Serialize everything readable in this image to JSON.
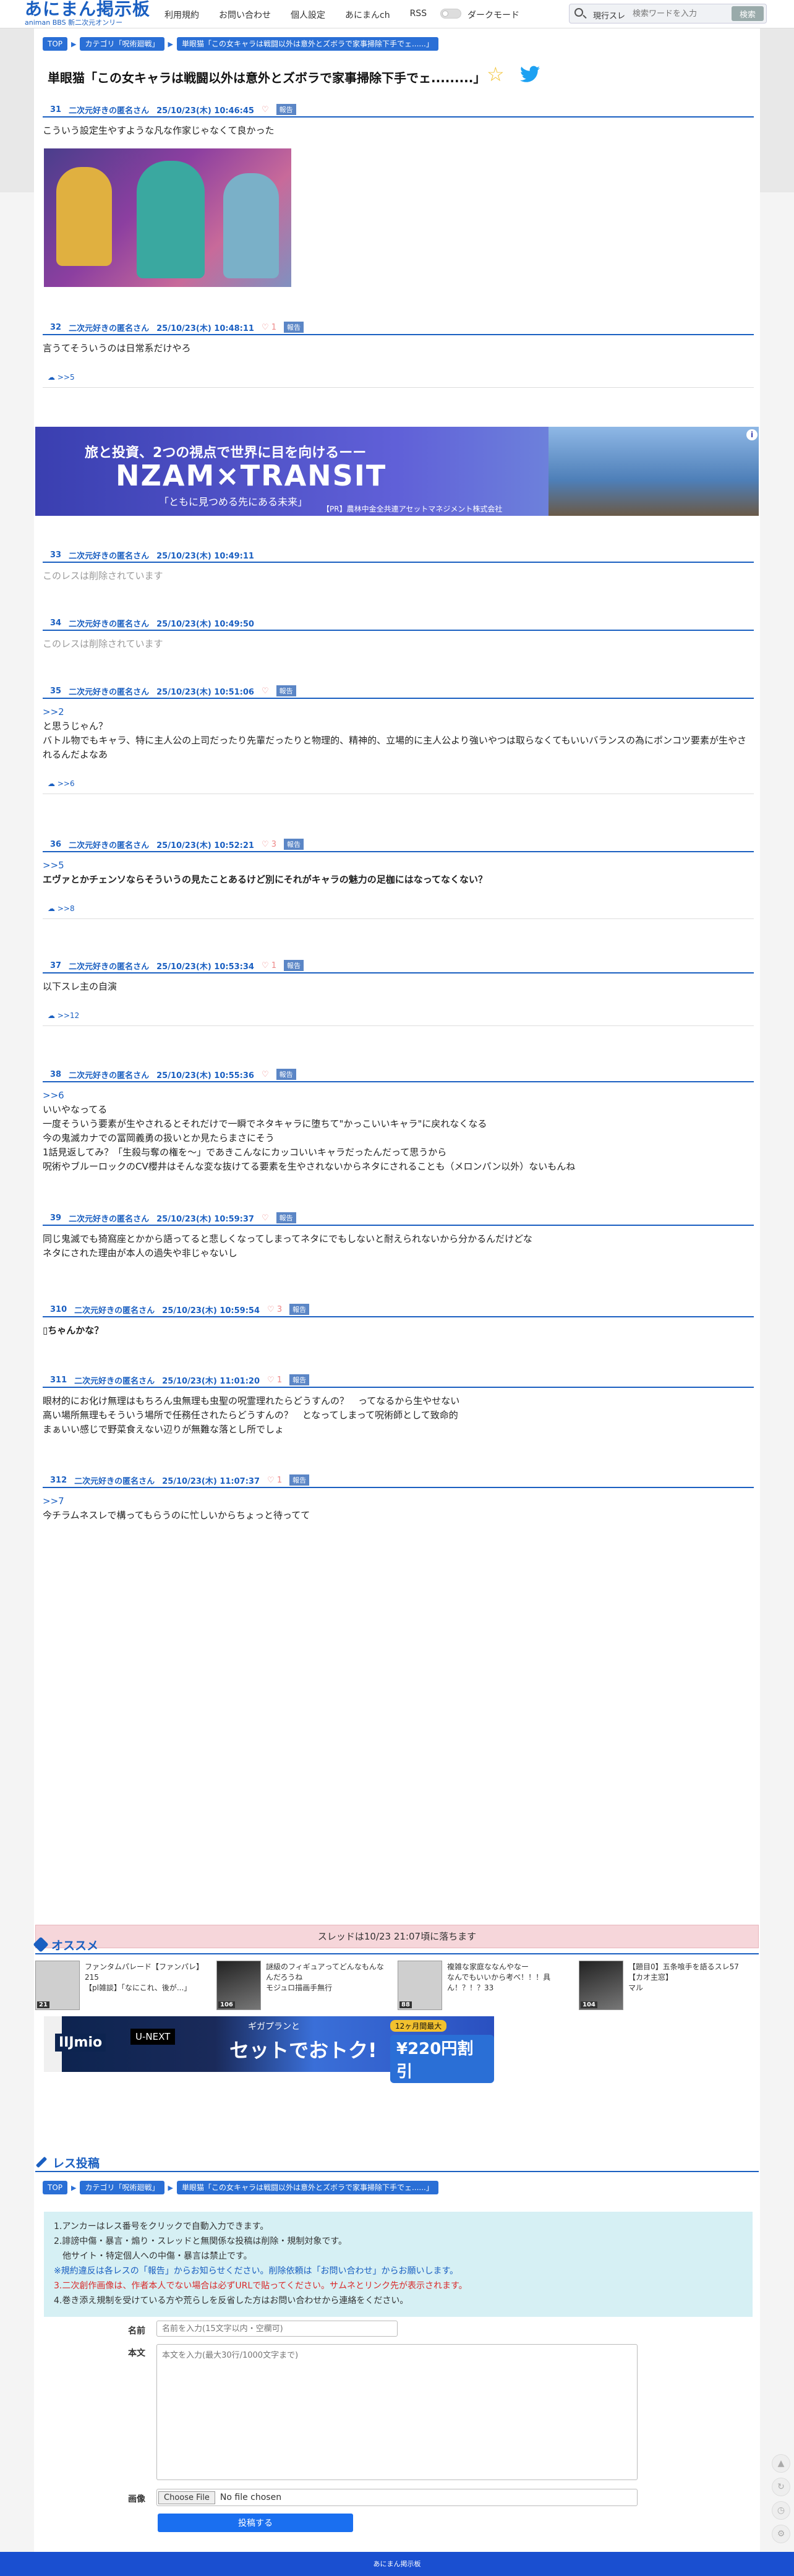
{
  "header": {
    "logo": "あにまん掲示板",
    "logo_sub": "animan BBS 新二次元オンリー",
    "nav": [
      "利用規約",
      "お問い合わせ",
      "個人設定",
      "あにまんch",
      "RSS"
    ],
    "dark_mode_label": "ダークモード",
    "search_scope": "現行スレ",
    "search_placeholder": "検索ワードを入力",
    "search_button": "検索"
  },
  "breadcrumb": {
    "top": "TOP",
    "category": "カテゴリ「呪術廻戦」",
    "thread": "単眼猫「この女キャラは戦闘以外は意外とズボラで家事掃除下手でェ......」"
  },
  "thread_title": "単眼猫「この女キャラは戦闘以外は意外とズボラで家事掃除下手でェ.........」",
  "posts": [
    {
      "num": "31",
      "name": "二次元好きの匿名さん",
      "date": "25/10/23(木) 10:46:45",
      "likes": "",
      "report": "報告",
      "lines": [
        "こういう設定生やすような凡な作家じゃなくて良かった"
      ]
    },
    {
      "num": "32",
      "name": "二次元好きの匿名さん",
      "date": "25/10/23(木) 10:48:11",
      "likes": "1",
      "report": "報告",
      "lines": [
        "言うてそういうのは日常系だけやろ"
      ],
      "replies": ">>5"
    },
    {
      "num": "33",
      "name": "二次元好きの匿名さん",
      "date": "25/10/23(木) 10:49:11",
      "deleted": "このレスは削除されています"
    },
    {
      "num": "34",
      "name": "二次元好きの匿名さん",
      "date": "25/10/23(木) 10:49:50",
      "deleted": "このレスは削除されています"
    },
    {
      "num": "35",
      "name": "二次元好きの匿名さん",
      "date": "25/10/23(木) 10:51:06",
      "likes": "",
      "report": "報告",
      "anchor": ">>2",
      "lines": [
        "と思うじゃん？",
        "バトル物でもキャラ、特に主人公の上司だったり先輩だったりと物理的、精神的、立場的に主人公より強いやつは取らなくてもいいバランスの為にポンコツ要素が生やされるんだよなあ"
      ],
      "replies": ">>6"
    },
    {
      "num": "36",
      "name": "二次元好きの匿名さん",
      "date": "25/10/23(木) 10:52:21",
      "likes": "3",
      "report": "報告",
      "anchor": ">>5",
      "lines": [
        "エヴァとかチェンソならそういうの見たことあるけど別にそれがキャラの魅力の足枷にはなってなくない？"
      ],
      "replies": ">>8"
    },
    {
      "num": "37",
      "name": "二次元好きの匿名さん",
      "date": "25/10/23(木) 10:53:34",
      "likes": "1",
      "report": "報告",
      "lines": [
        "以下スレ主の自演"
      ],
      "replies": ">>12"
    },
    {
      "num": "38",
      "name": "二次元好きの匿名さん",
      "date": "25/10/23(木) 10:55:36",
      "likes": "",
      "report": "報告",
      "anchor": ">>6",
      "lines": [
        "いいやなってる",
        "一度そういう要素が生やされるとそれだけで一瞬でネタキャラに堕ちて\"かっこいいキャラ\"に戻れなくなる",
        "今の鬼滅カナでの冨岡義勇の扱いとか見たらまさにそう",
        "1話見返してみ？「生殺与奪の権を〜」であきこんなにカッコいいキャラだったんだって思うから",
        "呪術やブルーロックのCV櫻井はそんな変な抜けてる要素を生やされないからネタにされることも（メロンパン以外）ないもんね"
      ]
    },
    {
      "num": "39",
      "name": "二次元好きの匿名さん",
      "date": "25/10/23(木) 10:59:37",
      "likes": "",
      "report": "報告",
      "lines": [
        "同じ鬼滅でも猗窩座とかから語ってると悲しくなってしまってネタにでもしないと耐えられないから分かるんだけどな",
        "ネタにされた理由が本人の過失や非じゃないし"
      ]
    },
    {
      "num": "310",
      "name": "二次元好きの匿名さん",
      "date": "25/10/23(木) 10:59:54",
      "likes": "3",
      "report": "報告",
      "lines": [
        "▯ちゃんかな？"
      ]
    },
    {
      "num": "311",
      "name": "二次元好きの匿名さん",
      "date": "25/10/23(木) 11:01:20",
      "likes": "1",
      "report": "報告",
      "lines": [
        "眼材的にお化け無理はもちろん虫無理も虫聖の呪霊理れたらどうすんの？　ってなるから生やせない",
        "高い場所無理もそういう場所で任務任されたらどうすんの？　となってしまって呪術師として致命的",
        "まぁいい感じで野菜食えない辺りが無難な落とし所でしょ"
      ]
    },
    {
      "num": "312",
      "name": "二次元好きの匿名さん",
      "date": "25/10/23(木) 11:07:37",
      "likes": "1",
      "report": "報告",
      "anchor": ">>7",
      "lines": [
        "今チラムネスレで構ってもらうのに忙しいからちょっと待ってて"
      ]
    }
  ],
  "ad1": {
    "line1": "旅と投資、2つの視点で世界に目を向けるーー",
    "brand": "NZAM×TRANSIT",
    "line2": "「ともに見つめる先にある未来」",
    "pr": "【PR】農林中金全共連アセットマネジメント株式会社"
  },
  "expire_notice": "スレッドは10/23 21:07頃に落ちます",
  "recommend": {
    "heading": "オススメ",
    "items": [
      {
        "title": "ファンタムパレード【ファンパレ】215",
        "sub": "【pl雑談】「なにこれ、後が...」",
        "count": "21"
      },
      {
        "title": "謎級のフィギュアってどんなもんなんだろうね",
        "sub": "モジュロ描画手無行",
        "count": "106"
      },
      {
        "title": "複雑な家庭ななんやなー",
        "sub": "なんでもいいから考べ！！！具ん！？！？33",
        "count": "88"
      },
      {
        "title": "【題目0】五条喰手を語るスレ57【カオ主窓】",
        "sub": "マル",
        "count": "104"
      }
    ]
  },
  "ad2": {
    "iij": "IIJmio",
    "unext": "U-NEXT",
    "sub": "ギガプランと",
    "main": "セットでおトク!",
    "gold": "12ヶ月間最大",
    "price": "¥220円割引"
  },
  "post_form": {
    "heading": "レス投稿",
    "rules": [
      "1.アンカーはレス番号をクリックで自動入力できます。",
      "2.誹謗中傷・暴言・煽り・スレッドと無関係な投稿は削除・規制対象です。",
      "　他サイト・特定個人への中傷・暴言は禁止です。",
      "※規約違反は各レスの「報告」からお知らせください。削除依頼は「お問い合わせ」からお願いします。",
      "3.二次創作画像は、作者本人でない場合は必ずURLで貼ってください。サムネとリンク先が表示されます。",
      "4.巻き添え規制を受けている方や荒らしを反省した方はお問い合わせから連絡をください。"
    ],
    "name_label": "名前",
    "name_placeholder": "名前を入力(15文字以内・空欄可)",
    "body_label": "本文",
    "body_placeholder": "本文を入力(最大30行/1000文字まで)",
    "image_label": "画像",
    "file_button": "Choose File",
    "file_status": "No file chosen",
    "submit": "投稿する"
  },
  "footer": "あにまん掲示板",
  "colors": {
    "accent": "#1a5fc1",
    "report": "#5b86c6",
    "expire_bg": "#f6d6da",
    "rules_bg": "#d6f0f4",
    "footer": "#1a4fd0"
  }
}
